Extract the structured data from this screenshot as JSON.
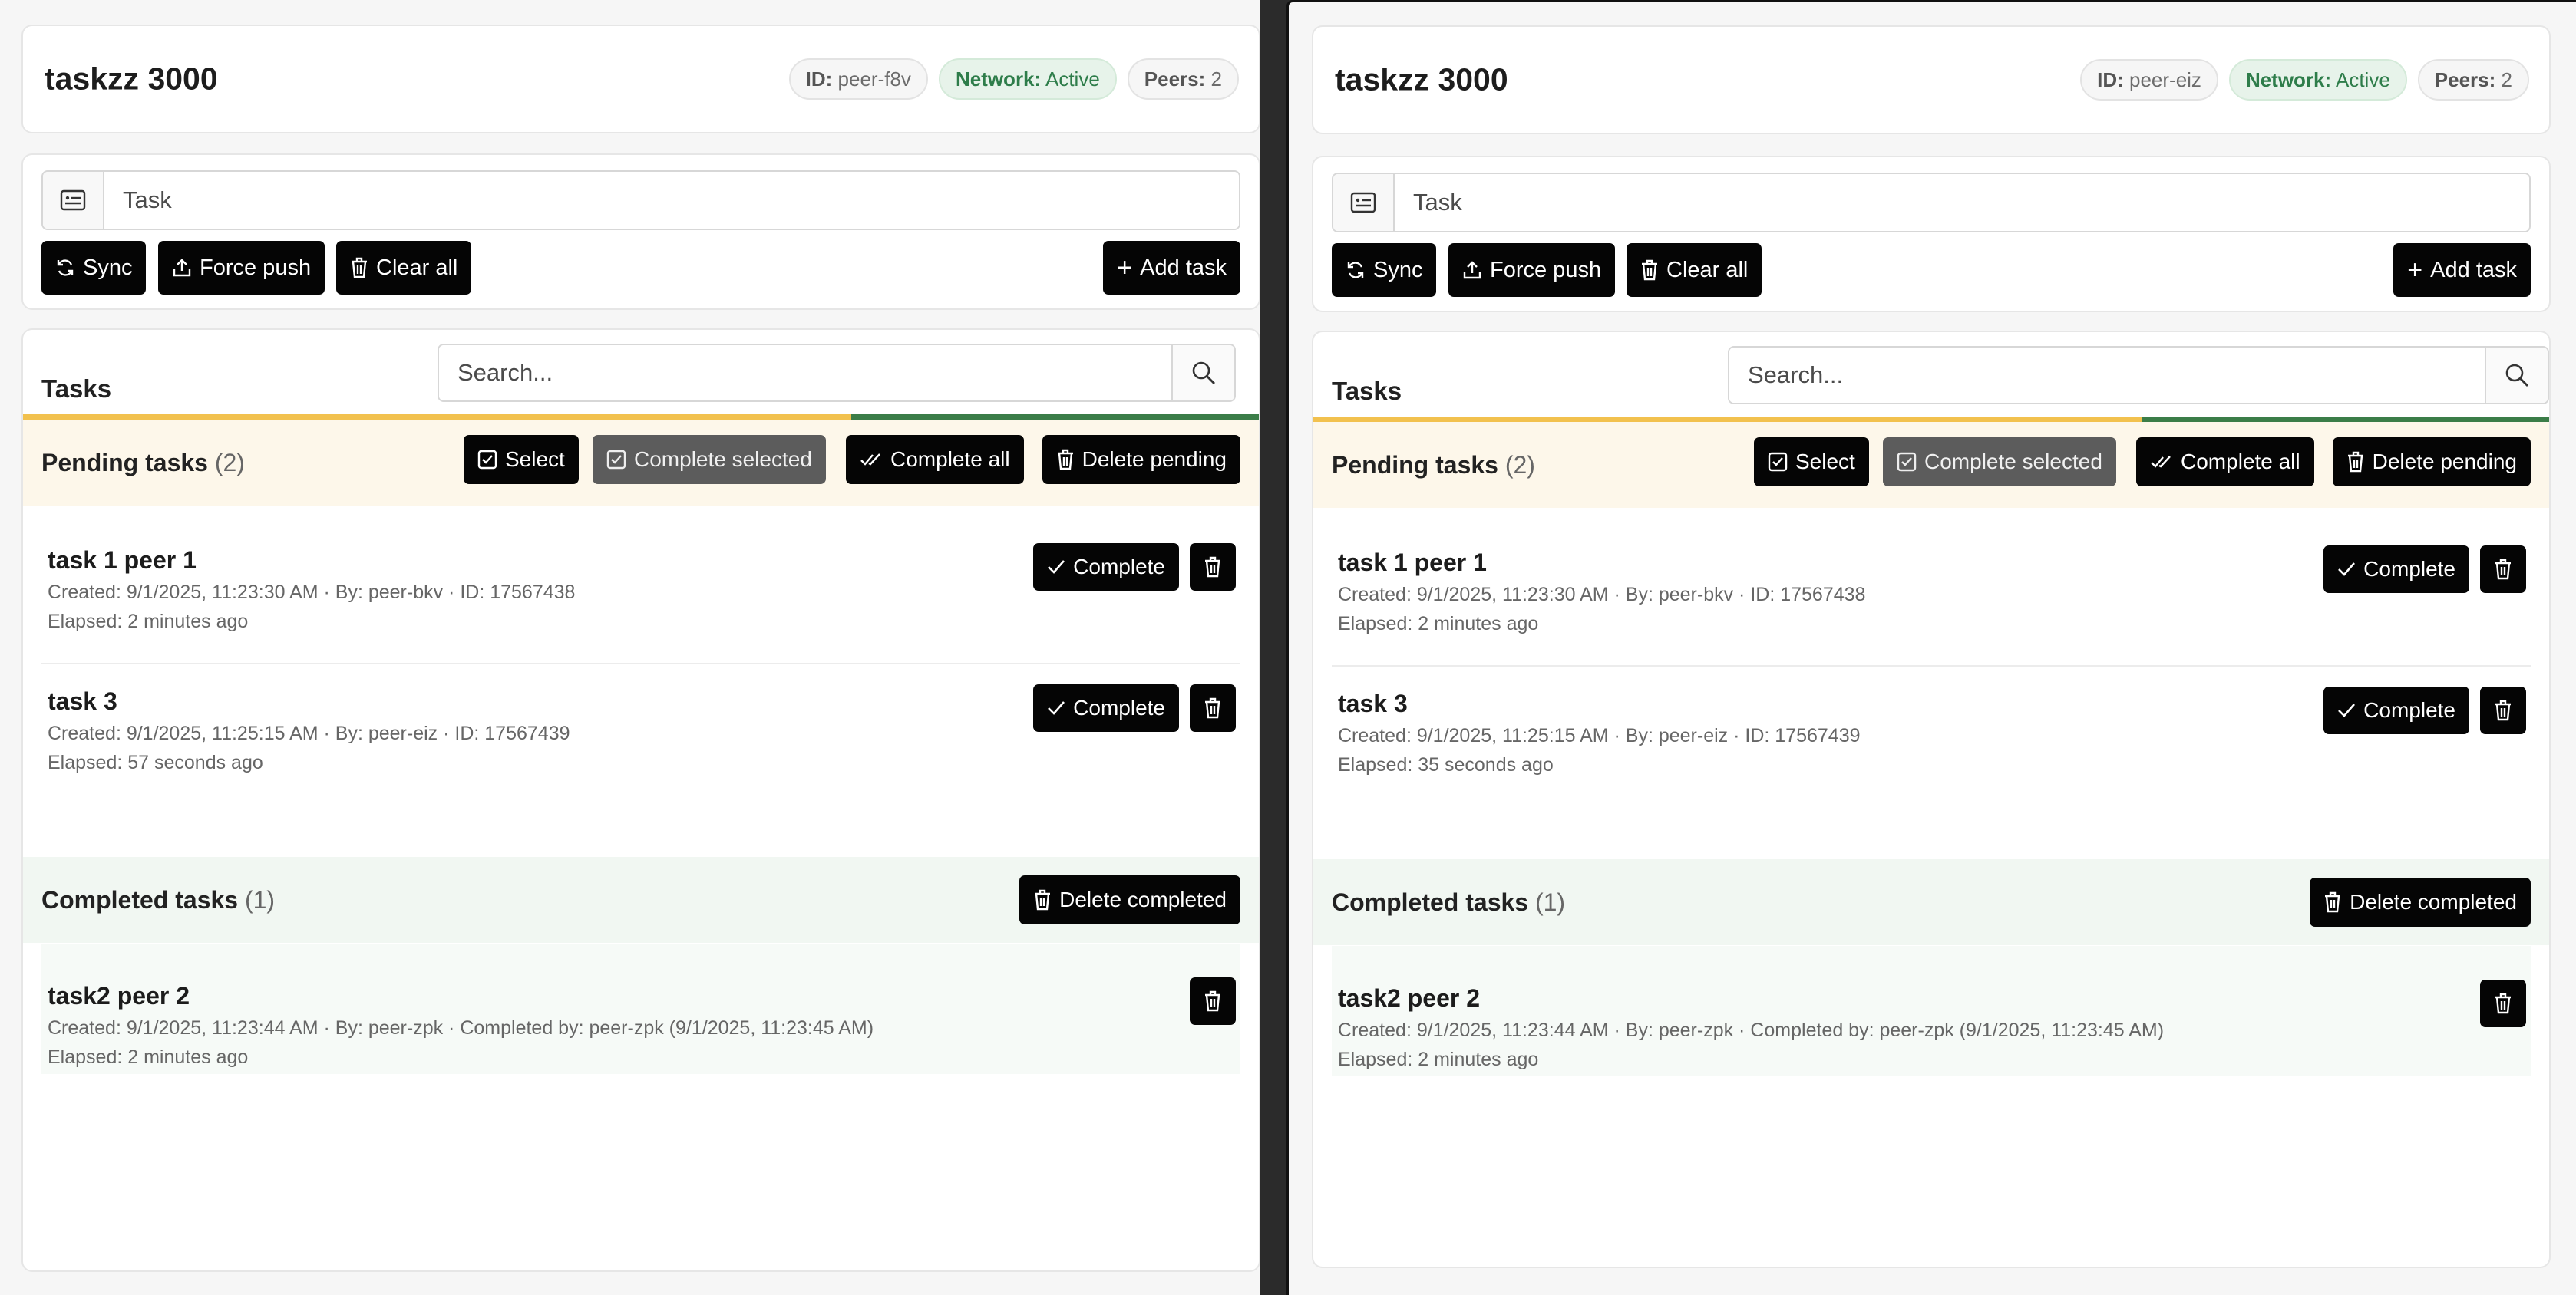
{
  "windows": [
    {
      "app_title": "taskzz 3000",
      "peer_id_label": "ID:",
      "peer_id": "peer-f8v",
      "network_label": "Network:",
      "network_status": "Active",
      "peers_label": "Peers:",
      "peers_count": "2",
      "task_input": {
        "placeholder": "Task"
      },
      "toolbar": {
        "sync": "Sync",
        "force_push": "Force push",
        "clear_all": "Clear all",
        "add_task": "Add task"
      },
      "tasks_heading": "Tasks",
      "search": {
        "placeholder": "Search..."
      },
      "progress": {
        "pending_fraction": 0.67,
        "completed_fraction": 0.33
      },
      "pending": {
        "title": "Pending tasks",
        "count": "(2)",
        "actions": {
          "select": "Select",
          "complete_selected": "Complete selected",
          "complete_all": "Complete all",
          "delete_pending": "Delete pending"
        },
        "items": [
          {
            "name": "task 1 peer 1",
            "meta": "Created: 9/1/2025, 11:23:30 AM · By: peer-bkv · ID: 17567438",
            "elapsed": "Elapsed: 2 minutes ago",
            "complete_label": "Complete"
          },
          {
            "name": "task 3",
            "meta": "Created: 9/1/2025, 11:25:15 AM · By: peer-eiz · ID: 17567439",
            "elapsed": "Elapsed: 57 seconds ago",
            "complete_label": "Complete"
          }
        ]
      },
      "completed": {
        "title": "Completed tasks",
        "count": "(1)",
        "delete_completed": "Delete completed",
        "items": [
          {
            "name": "task2 peer 2",
            "meta": "Created: 9/1/2025, 11:23:44 AM · By: peer-zpk · Completed by: peer-zpk (9/1/2025, 11:23:45 AM)",
            "elapsed": "Elapsed: 2 minutes ago"
          }
        ]
      }
    },
    {
      "app_title": "taskzz 3000",
      "peer_id_label": "ID:",
      "peer_id": "peer-eiz",
      "network_label": "Network:",
      "network_status": "Active",
      "peers_label": "Peers:",
      "peers_count": "2",
      "task_input": {
        "placeholder": "Task"
      },
      "toolbar": {
        "sync": "Sync",
        "force_push": "Force push",
        "clear_all": "Clear all",
        "add_task": "Add task"
      },
      "tasks_heading": "Tasks",
      "search": {
        "placeholder": "Search..."
      },
      "progress": {
        "pending_fraction": 0.67,
        "completed_fraction": 0.33
      },
      "pending": {
        "title": "Pending tasks",
        "count": "(2)",
        "actions": {
          "select": "Select",
          "complete_selected": "Complete selected",
          "complete_all": "Complete all",
          "delete_pending": "Delete pending"
        },
        "items": [
          {
            "name": "task 1 peer 1",
            "meta": "Created: 9/1/2025, 11:23:30 AM · By: peer-bkv · ID: 17567438",
            "elapsed": "Elapsed: 2 minutes ago",
            "complete_label": "Complete"
          },
          {
            "name": "task 3",
            "meta": "Created: 9/1/2025, 11:25:15 AM · By: peer-eiz · ID: 17567439",
            "elapsed": "Elapsed: 35 seconds ago",
            "complete_label": "Complete"
          }
        ]
      },
      "completed": {
        "title": "Completed tasks",
        "count": "(1)",
        "delete_completed": "Delete completed",
        "items": [
          {
            "name": "task2 peer 2",
            "meta": "Created: 9/1/2025, 11:23:44 AM · By: peer-zpk · Completed by: peer-zpk (9/1/2025, 11:23:45 AM)",
            "elapsed": "Elapsed: 2 minutes ago"
          }
        ]
      }
    }
  ]
}
